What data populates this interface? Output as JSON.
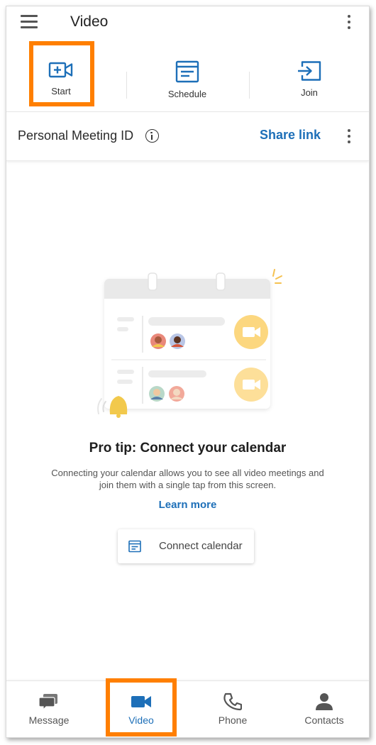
{
  "header": {
    "title": "Video"
  },
  "actions": [
    {
      "label": "Start"
    },
    {
      "label": "Schedule"
    },
    {
      "label": "Join"
    }
  ],
  "meeting_bar": {
    "label": "Personal Meeting ID",
    "share_label": "Share link"
  },
  "empty_state": {
    "title": "Pro tip: Connect your calendar",
    "description": "Connecting your calendar allows you to see all video meetings and join them with a single tap from this screen.",
    "learn_more": "Learn more",
    "button_label": "Connect calendar"
  },
  "bottom_nav": {
    "items": [
      {
        "label": "Message",
        "icon": "message-icon"
      },
      {
        "label": "Video",
        "icon": "video-camera-icon"
      },
      {
        "label": "Phone",
        "icon": "phone-icon"
      },
      {
        "label": "Contacts",
        "icon": "contacts-icon"
      }
    ],
    "active": "Video"
  },
  "colors": {
    "accent": "#1d6fb8",
    "highlight": "#ff7f00",
    "illustration_accent": "#fcd77f"
  }
}
